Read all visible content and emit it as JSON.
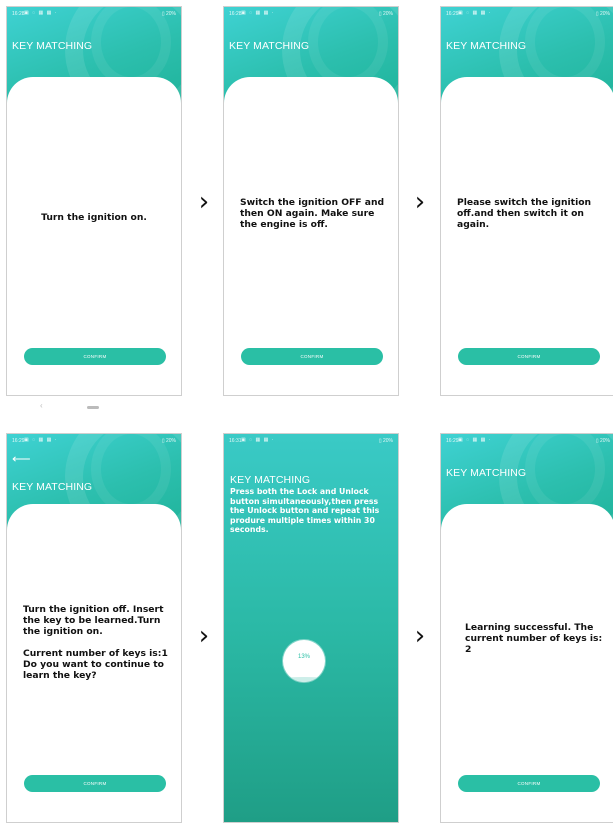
{
  "status": {
    "icons": "▣ ◌ ▦ ▦ ·",
    "battery_glyph": "▯"
  },
  "screens": [
    {
      "time": "16:28",
      "battery": "20%",
      "title": "KEY MATCHING",
      "message": [
        "Turn the ignition on."
      ],
      "confirm": "CONFIRM"
    },
    {
      "time": "16:28",
      "battery": "20%",
      "title": "KEY MATCHING",
      "message": [
        "Switch the ignition OFF and then ON again. Make sure the engine is off."
      ],
      "confirm": "CONFIRM"
    },
    {
      "time": "16:29",
      "battery": "20%",
      "title": "KEY MATCHING",
      "message": [
        "Please switch the ignition off.and then switch it on again."
      ],
      "confirm": "CONFIRM"
    },
    {
      "time": "16:29",
      "battery": "20%",
      "title": "KEY MATCHING",
      "message": [
        "Turn the ignition off. Insert the key to be learned.Turn the ignition on.",
        "Current number of keys is:1 Do you want to continue to learn the key?"
      ],
      "confirm": "CONFIRM"
    },
    {
      "time": "16:31",
      "battery": "20%",
      "title": "KEY MATCHING",
      "message": [
        "Press both the Lock and Unlock button simultaneously,then press the Unlock button and repeat this produre multiple times within 30 seconds."
      ],
      "progress_label": "13%",
      "progress_value": 0.13
    },
    {
      "time": "16:29",
      "battery": "20%",
      "title": "KEY MATCHING",
      "message": [
        "Learning successful. The current number of keys is: 2"
      ],
      "confirm": "CONFIRM"
    }
  ],
  "navigation": {
    "next_glyph": "›",
    "back_glyph": "‹",
    "left_arrow": "⟵"
  },
  "colors": {
    "accent": "#2abfa5",
    "header_start": "#3fd2d3",
    "header_end": "#1fb39a"
  }
}
